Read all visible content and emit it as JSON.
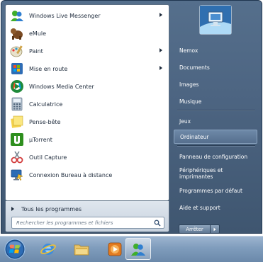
{
  "programs": [
    {
      "label": "Windows Live Messenger",
      "icon": "messenger-icon",
      "has_submenu": true
    },
    {
      "label": "eMule",
      "icon": "emule-icon",
      "has_submenu": false
    },
    {
      "label": "Paint",
      "icon": "paint-icon",
      "has_submenu": true
    },
    {
      "label": "Mise en route",
      "icon": "getting-started-icon",
      "has_submenu": true
    },
    {
      "label": "Windows Media Center",
      "icon": "media-center-icon",
      "has_submenu": false
    },
    {
      "label": "Calculatrice",
      "icon": "calculator-icon",
      "has_submenu": false
    },
    {
      "label": "Pense-bête",
      "icon": "sticky-notes-icon",
      "has_submenu": false
    },
    {
      "label": "µTorrent",
      "icon": "utorrent-icon",
      "has_submenu": false
    },
    {
      "label": "Outil Capture",
      "icon": "snipping-tool-icon",
      "has_submenu": false
    },
    {
      "label": "Connexion Bureau à distance",
      "icon": "remote-desktop-icon",
      "has_submenu": false
    }
  ],
  "all_programs_label": "Tous les programmes",
  "search": {
    "placeholder": "Rechercher les programmes et fichiers"
  },
  "right_items": [
    {
      "label": "Nemox"
    },
    {
      "label": "Documents"
    },
    {
      "label": "Images"
    },
    {
      "label": "Musique"
    },
    {
      "label": "Jeux"
    },
    {
      "label": "Ordinateur",
      "highlighted": true
    },
    {
      "label": "Panneau de configuration"
    },
    {
      "label": "Périphériques et imprimantes"
    },
    {
      "label": "Programmes par défaut"
    },
    {
      "label": "Aide et support"
    }
  ],
  "shutdown": {
    "label": "Arrêter"
  },
  "taskbar": [
    "start-orb-icon",
    "internet-explorer-icon",
    "explorer-folder-icon",
    "media-player-icon",
    "messenger-icon"
  ],
  "colors": {
    "menu_bg": "#4d6582",
    "taskbar": "#7f9cbc",
    "left_pane": "#ffffff"
  }
}
